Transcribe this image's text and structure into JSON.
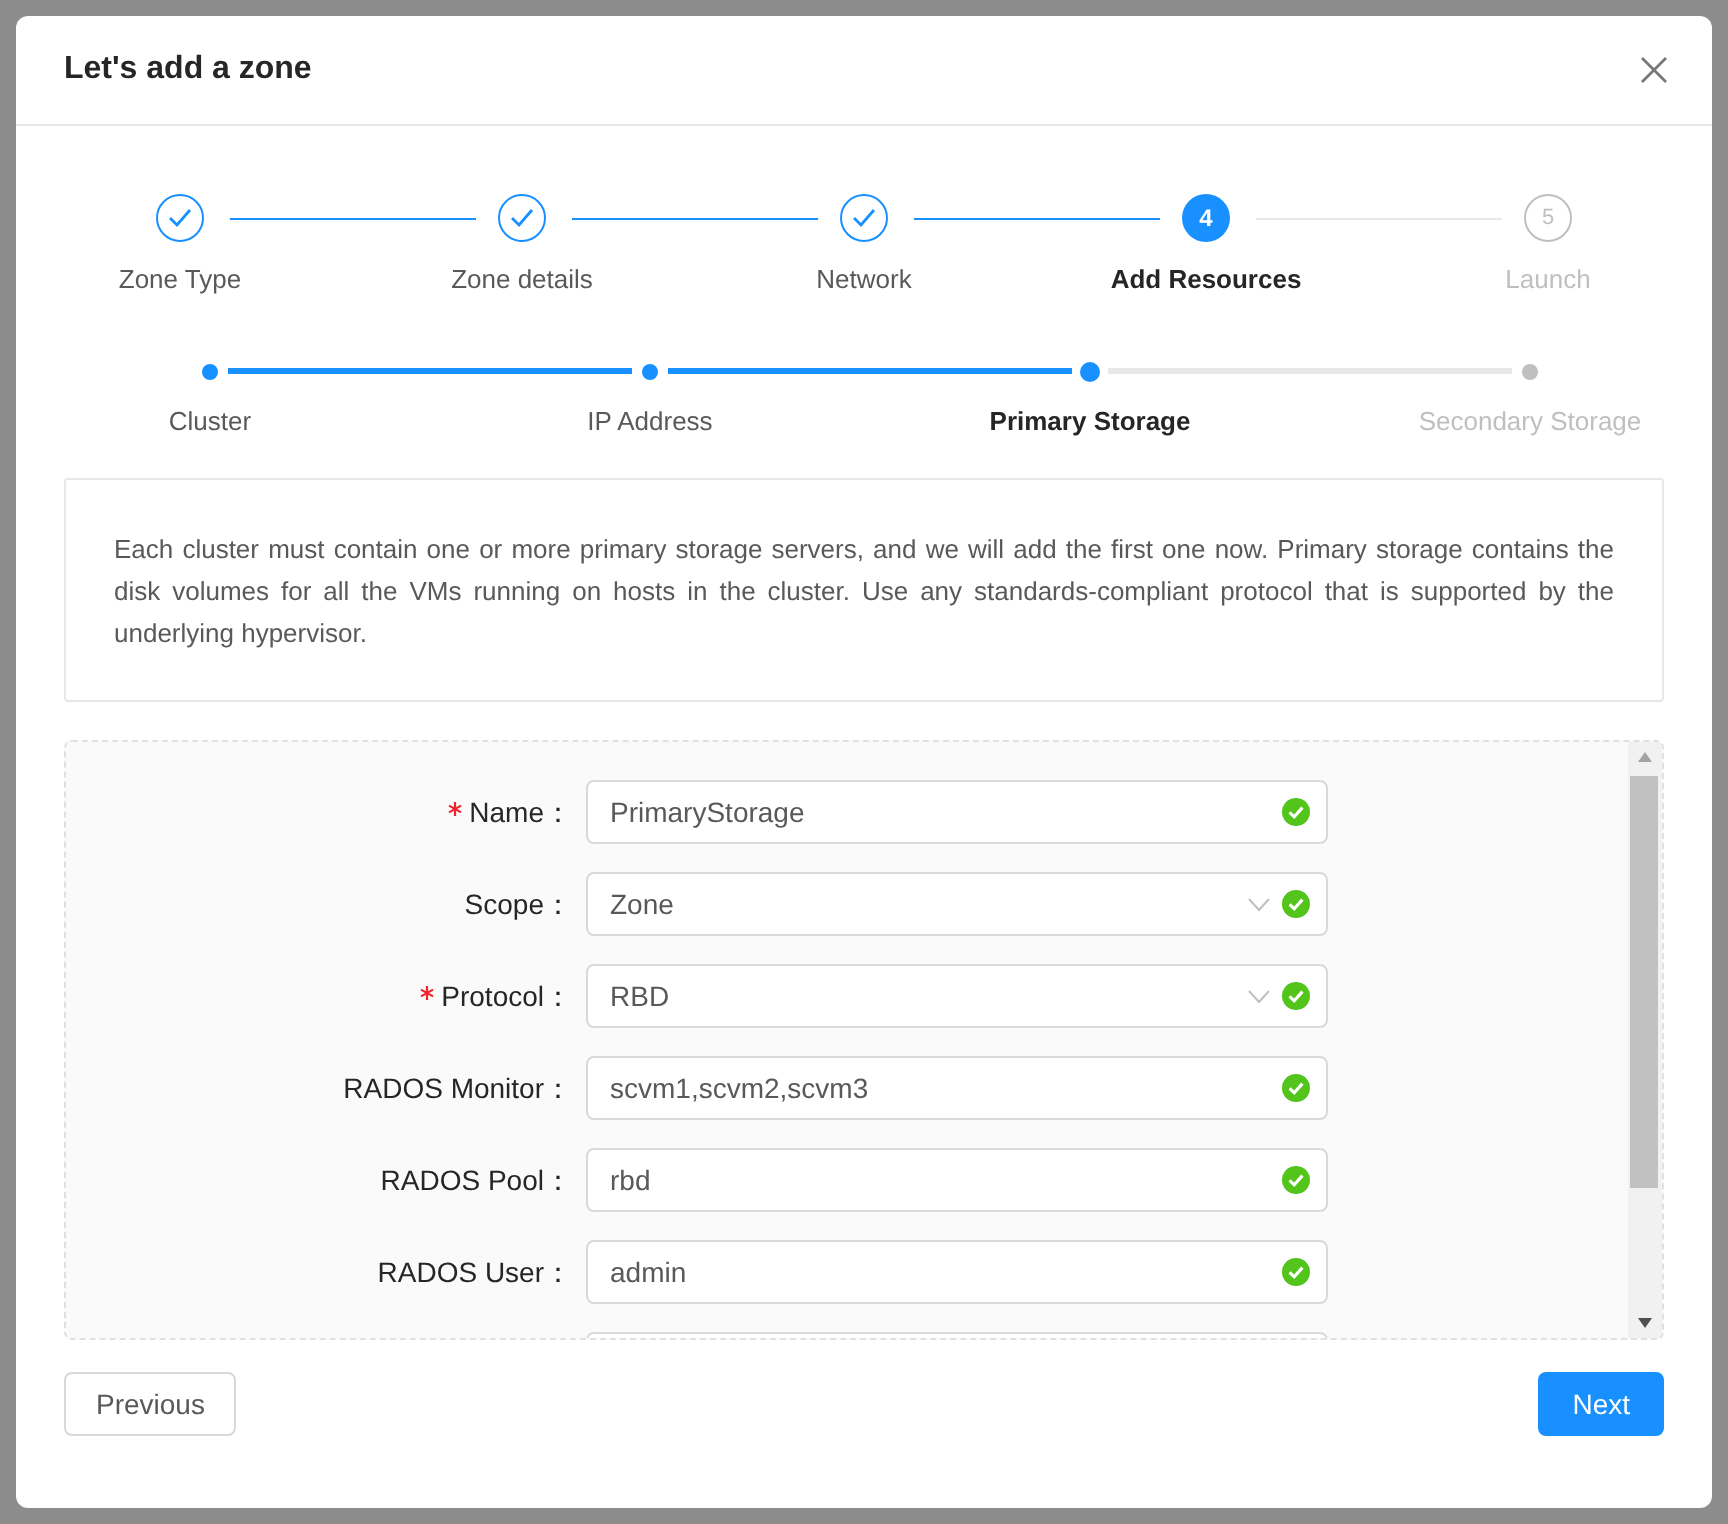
{
  "dialog": {
    "title": "Let's add a zone"
  },
  "steps": [
    {
      "label": "Zone Type",
      "completed": true,
      "current": false
    },
    {
      "label": "Zone details",
      "completed": true,
      "current": false
    },
    {
      "label": "Network",
      "completed": true,
      "current": false
    },
    {
      "label": "Add Resources",
      "completed": false,
      "current": true,
      "number": "4"
    },
    {
      "label": "Launch",
      "completed": false,
      "current": false,
      "number": "5"
    }
  ],
  "substeps": [
    {
      "label": "Cluster",
      "completed": true,
      "current": false
    },
    {
      "label": "IP Address",
      "completed": true,
      "current": false
    },
    {
      "label": "Primary Storage",
      "completed": false,
      "current": true
    },
    {
      "label": "Secondary Storage",
      "completed": false,
      "current": false
    }
  ],
  "description": "Each cluster must contain one or more primary storage servers, and we will add the first one now. Primary storage contains the disk volumes for all the VMs running on hosts in the cluster. Use any standards-compliant protocol that is supported by the underlying hypervisor.",
  "form": {
    "fields": [
      {
        "label": "Name：",
        "required": true,
        "kind": "input",
        "value": "PrimaryStorage",
        "valid": true
      },
      {
        "label": "Scope：",
        "required": false,
        "kind": "select",
        "value": "Zone",
        "valid": true
      },
      {
        "label": "Protocol：",
        "required": true,
        "kind": "select",
        "value": "RBD",
        "valid": true
      },
      {
        "label": "RADOS Monitor：",
        "required": false,
        "kind": "input",
        "value": "scvm1,scvm2,scvm3",
        "valid": true
      },
      {
        "label": "RADOS Pool：",
        "required": false,
        "kind": "input",
        "value": "rbd",
        "valid": true
      },
      {
        "label": "RADOS User：",
        "required": false,
        "kind": "input",
        "value": "admin",
        "valid": true
      },
      {
        "kind": "input"
      }
    ]
  },
  "buttons": {
    "previous": "Previous",
    "next": "Next"
  }
}
